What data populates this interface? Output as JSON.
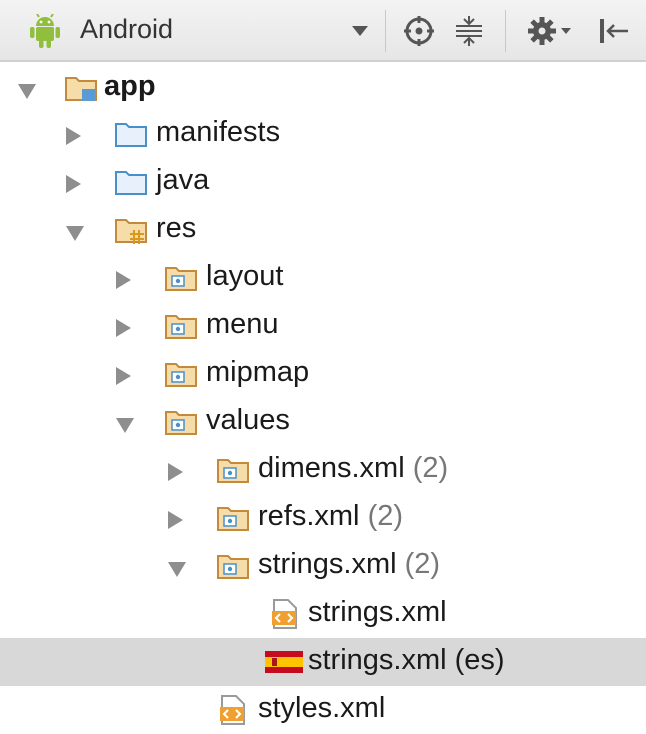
{
  "toolbar": {
    "title": "Android",
    "icons": [
      "android-icon",
      "dropdown-arrow",
      "target-icon",
      "collapse-icon",
      "gear-icon",
      "hide-icon"
    ]
  },
  "tree": [
    {
      "label": "app",
      "count": "",
      "expanded": true,
      "icon": "module-folder-icon"
    },
    {
      "label": "manifests",
      "count": "",
      "expanded": false,
      "icon": "folder-icon"
    },
    {
      "label": "java",
      "count": "",
      "expanded": false,
      "icon": "folder-icon"
    },
    {
      "label": "res",
      "count": "",
      "expanded": true,
      "icon": "res-folder-icon"
    },
    {
      "label": "layout",
      "count": "",
      "expanded": false,
      "icon": "res-subfolder-icon"
    },
    {
      "label": "menu",
      "count": "",
      "expanded": false,
      "icon": "res-subfolder-icon"
    },
    {
      "label": "mipmap",
      "count": "",
      "expanded": false,
      "icon": "res-subfolder-icon"
    },
    {
      "label": "values",
      "count": "",
      "expanded": true,
      "icon": "res-subfolder-icon"
    },
    {
      "label": "dimens.xml",
      "count": "(2)",
      "expanded": false,
      "icon": "res-subfolder-icon"
    },
    {
      "label": "refs.xml",
      "count": "(2)",
      "expanded": false,
      "icon": "res-subfolder-icon"
    },
    {
      "label": "strings.xml",
      "count": "(2)",
      "expanded": true,
      "icon": "res-subfolder-icon"
    },
    {
      "label": "strings.xml",
      "count": "",
      "expanded": null,
      "icon": "xml-file-icon"
    },
    {
      "label": "strings.xml (es)",
      "count": "",
      "expanded": null,
      "icon": "spain-flag-icon",
      "selected": true
    },
    {
      "label": "styles.xml",
      "count": "",
      "expanded": null,
      "icon": "xml-file-icon"
    }
  ]
}
